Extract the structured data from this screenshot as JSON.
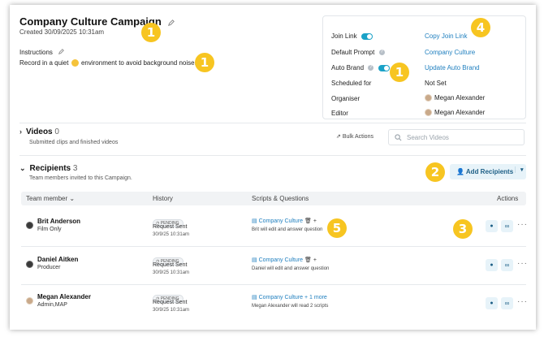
{
  "campaign": {
    "title": "Company Culture Campaign",
    "created": "Created 30/09/2025 10:31am",
    "instructions_label": "Instructions",
    "instructions_before": "Record in a quiet",
    "instructions_after": "environment to avoid background noise."
  },
  "badges": {
    "b1": "1",
    "b2": "2",
    "b3": "3",
    "b4": "4",
    "b5": "5"
  },
  "settings": {
    "join_link_label": "Join Link",
    "join_link_value": "Copy Join Link",
    "default_prompt_label": "Default Prompt",
    "default_prompt_value": "Company Culture",
    "auto_brand_label": "Auto Brand",
    "auto_brand_value": "Update Auto Brand",
    "scheduled_label": "Scheduled for",
    "scheduled_value": "Not Set",
    "organiser_label": "Organiser",
    "organiser_value": "Megan Alexander",
    "editor_label": "Editor",
    "editor_value": "Megan Alexander"
  },
  "videos": {
    "title": "Videos",
    "count": "0",
    "subtitle": "Submitted clips and finished videos",
    "bulk_actions": "Bulk Actions",
    "search_placeholder": "Search Videos"
  },
  "recipients": {
    "title": "Recipients",
    "count": "3",
    "subtitle": "Team members invited to this Campaign.",
    "add_button": "Add Recipients"
  },
  "table": {
    "headers": {
      "member": "Team member",
      "history": "History",
      "scripts": "Scripts & Questions",
      "actions": "Actions"
    },
    "rows": [
      {
        "name": "Brit Anderson",
        "role": "Film Only",
        "status": "PENDING",
        "history": "Request Sent",
        "date": "30/9/25 10:31am",
        "script": "Company Culture",
        "extra": "",
        "desc": "Brit will edit and answer question"
      },
      {
        "name": "Daniel Aitken",
        "role": "Producer",
        "status": "PENDING",
        "history": "Request Sent",
        "date": "30/9/25 10:31am",
        "script": "Company Culture",
        "extra": "",
        "desc": "Daniel will edit and answer question"
      },
      {
        "name": "Megan Alexander",
        "role": "Admin,MAP",
        "status": "PENDING",
        "history": "Request Sent",
        "date": "30/9/25 10:31am",
        "script": "Company Culture",
        "extra": "+ 1 more",
        "desc": "Megan Alexander will read 2 scripts"
      }
    ]
  },
  "colors": {
    "accent": "#1f7fbf",
    "badge": "#f7c521",
    "toggle": "#1aa2c7"
  }
}
